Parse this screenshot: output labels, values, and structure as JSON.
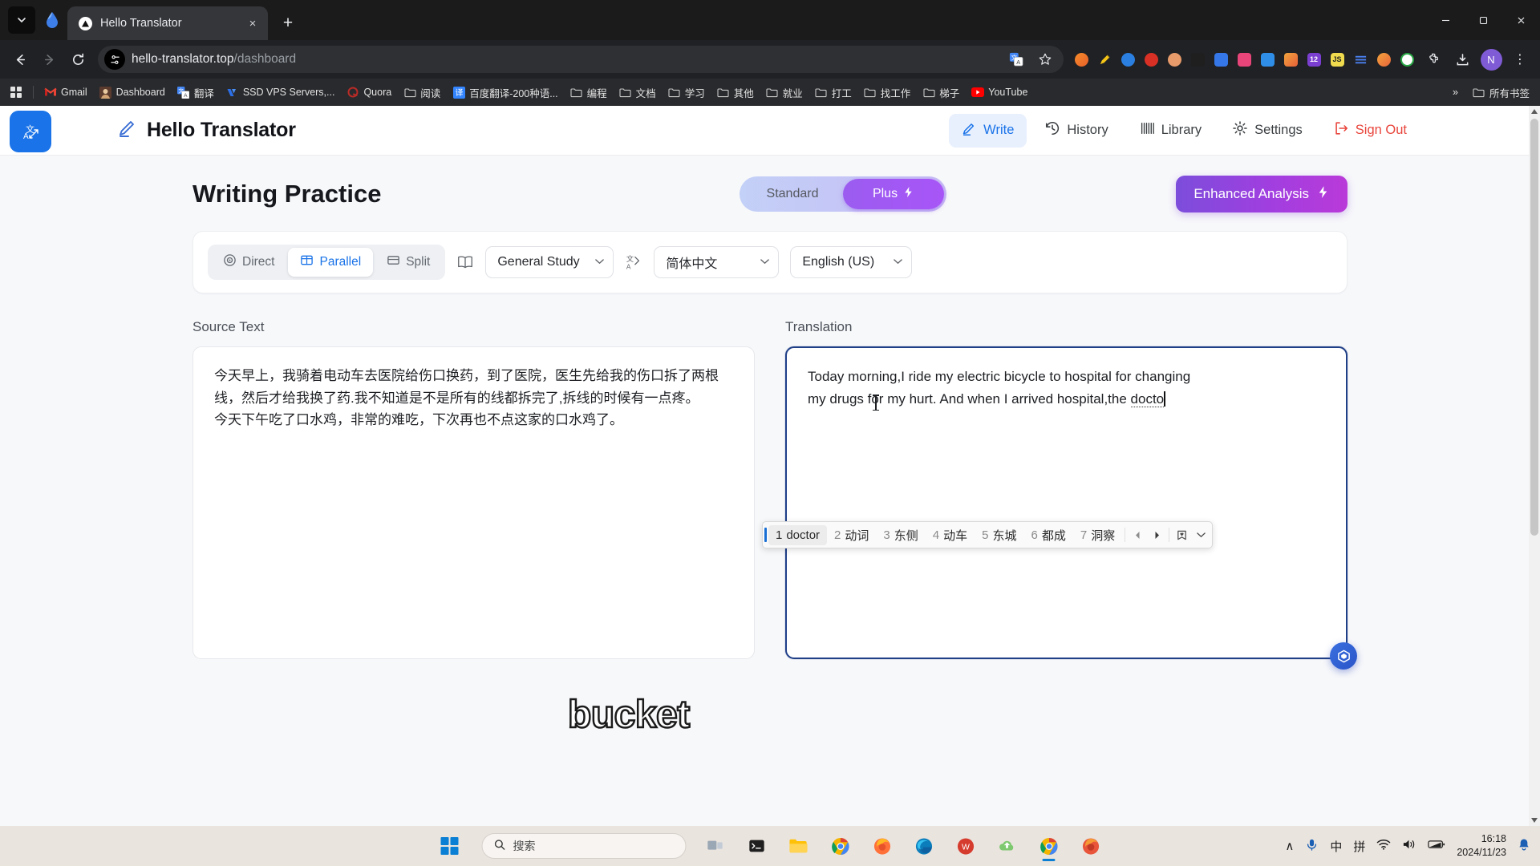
{
  "browser": {
    "tab": {
      "title": "Hello Translator",
      "close_label": "×",
      "favicon": "triangle-icon"
    },
    "new_tab_label": "+",
    "window_controls": {
      "minimize": "—",
      "maximize": "❐",
      "close": "✕"
    },
    "nav": {
      "back": "←",
      "forward": "→",
      "reload": "↻"
    },
    "omnibox": {
      "domain": "hello-translator.top",
      "path": "/dashboard",
      "site_info_icon": "tune-icon",
      "translate_icon": "translate-icon",
      "bookmark_icon": "star-icon"
    },
    "profile_initial": "N",
    "menu_icon": "⋮",
    "download_icon": "download-icon",
    "extensions_icon": "puzzle-icon",
    "bookmarks": [
      {
        "label": "Gmail",
        "icon": "gmail-icon"
      },
      {
        "label": "Dashboard",
        "icon": "dashboard-icon"
      },
      {
        "label": "翻译",
        "icon": "google-translate-icon"
      },
      {
        "label": "SSD VPS Servers,...",
        "icon": "vultr-icon"
      },
      {
        "label": "Quora",
        "icon": "quora-icon"
      },
      {
        "label": "阅读",
        "icon": "folder-icon"
      },
      {
        "label": "百度翻译-200种语...",
        "icon": "baidu-translate-icon"
      },
      {
        "label": "编程",
        "icon": "folder-icon"
      },
      {
        "label": "文档",
        "icon": "folder-icon"
      },
      {
        "label": "学习",
        "icon": "folder-icon"
      },
      {
        "label": "其他",
        "icon": "folder-icon"
      },
      {
        "label": "就业",
        "icon": "folder-icon"
      },
      {
        "label": "打工",
        "icon": "folder-icon"
      },
      {
        "label": "找工作",
        "icon": "folder-icon"
      },
      {
        "label": "梯子",
        "icon": "folder-icon"
      },
      {
        "label": "YouTube",
        "icon": "youtube-icon"
      }
    ],
    "bookmarks_overflow": "»",
    "all_bookmarks_label": "所有书签",
    "all_bookmarks_icon": "folder-icon",
    "extensions": [
      {
        "icon": "ext-orange-icon",
        "color": "#e8732a"
      },
      {
        "icon": "ext-pen-icon",
        "color": "#f5c518"
      },
      {
        "icon": "ext-blue-circle-icon",
        "color": "#2b7fe0"
      },
      {
        "icon": "ext-red-dot-icon",
        "color": "#dd3c2f"
      },
      {
        "icon": "ext-avatar-icon",
        "color": "#e79a6a"
      },
      {
        "icon": "ext-black-square-icon",
        "color": "#1f1f1f"
      },
      {
        "icon": "ext-blue-square-icon",
        "color": "#3577e8"
      },
      {
        "icon": "ext-pink-icon",
        "color": "#e8467a"
      },
      {
        "icon": "ext-cube-icon",
        "color": "#2f8fe8"
      },
      {
        "icon": "ext-grid-icon",
        "color": "#e86a3a"
      },
      {
        "icon": "ext-badge-12-icon",
        "color": "#7a3fd0",
        "badge": "12"
      },
      {
        "icon": "ext-js-icon",
        "color": "#f0db4f"
      },
      {
        "icon": "ext-list-icon",
        "color": "#4a80f0"
      },
      {
        "icon": "ext-green-check-icon",
        "color": "#28a745"
      }
    ]
  },
  "app": {
    "logo_icon": "translate-expand-icon",
    "brand": "Hello Translator",
    "brand_icon": "pencil-icon",
    "nav": [
      {
        "label": "Write",
        "icon": "pencil-icon",
        "active": true
      },
      {
        "label": "History",
        "icon": "history-icon",
        "active": false
      },
      {
        "label": "Library",
        "icon": "library-icon",
        "active": false
      },
      {
        "label": "Settings",
        "icon": "gear-icon",
        "active": false
      },
      {
        "label": "Sign Out",
        "icon": "signout-icon",
        "active": false
      }
    ],
    "page_title": "Writing Practice",
    "plan": {
      "standard_label": "Standard",
      "plus_label": "Plus",
      "plus_icon": "lightning-icon",
      "selected": "Plus"
    },
    "enhanced_button": {
      "label": "Enhanced Analysis",
      "icon": "lightning-icon"
    },
    "toolbar": {
      "modes": [
        {
          "label": "Direct",
          "icon": "target-icon",
          "selected": false
        },
        {
          "label": "Parallel",
          "icon": "columns-icon",
          "selected": true
        },
        {
          "label": "Split",
          "icon": "split-icon",
          "selected": false
        }
      ],
      "book_icon": "book-icon",
      "topic_select": {
        "value": "General Study",
        "chevron": "▾"
      },
      "lang_icon": "language-swap-icon",
      "source_lang_select": {
        "value": "简体中文",
        "chevron": "▾"
      },
      "target_lang_select": {
        "value": "English (US)",
        "chevron": "▾"
      }
    },
    "source_panel": {
      "label": "Source Text",
      "lines": [
        "今天早上，我骑着电动车去医院给伤口换药，到了医院，医生先给我的伤口拆了两根线，然后才给我换了药.我不知道是不是所有的线都拆完了,拆线的时候有一点疼。",
        "今天下午吃了口水鸡，非常的难吃，下次再也不点这家的口水鸡了。"
      ]
    },
    "target_panel": {
      "label": "Translation",
      "text_before": "Today morning,I ride my electric bicycle to changing my drugs for my hurt. And when I arrived hospital,the ",
      "line1": "Today morning,I ride my electric bicycle to hospital for changing",
      "line2_a": "my drugs for my hurt. And when I arrived hospital,the ",
      "line2_composition": "docto"
    },
    "watermark": "bucket",
    "fab_icon": "assistant-icon"
  },
  "ime": {
    "candidates": [
      {
        "num": "1",
        "text": "doctor",
        "selected": true
      },
      {
        "num": "2",
        "text": "动词",
        "selected": false
      },
      {
        "num": "3",
        "text": "东侧",
        "selected": false
      },
      {
        "num": "4",
        "text": "动车",
        "selected": false
      },
      {
        "num": "5",
        "text": "东城",
        "selected": false
      },
      {
        "num": "6",
        "text": "都成",
        "selected": false
      },
      {
        "num": "7",
        "text": "洞察",
        "selected": false
      }
    ],
    "prev_icon": "◀",
    "next_icon": "▶",
    "tool_icon": "ime-tool-icon",
    "expand_icon": "⌄"
  },
  "taskbar": {
    "start_icon": "windows-icon",
    "search_placeholder": "搜索",
    "search_icon": "search-icon",
    "apps": [
      {
        "icon": "task-view-icon",
        "running": false
      },
      {
        "icon": "terminal-icon",
        "running": false
      },
      {
        "icon": "file-explorer-icon",
        "running": false
      },
      {
        "icon": "chrome-icon",
        "running": false
      },
      {
        "icon": "firefox-icon",
        "running": false
      },
      {
        "icon": "edge-icon",
        "running": false
      },
      {
        "icon": "wps-icon",
        "running": false
      },
      {
        "icon": "cloud-icon",
        "running": false
      },
      {
        "icon": "chrome-active-icon",
        "running": true
      },
      {
        "icon": "firefox-dev-icon",
        "running": false
      }
    ],
    "tray": {
      "chevron_up": "∧",
      "mic_icon": "mic-icon",
      "ime_mode": "中",
      "ime_pinyin": "拼",
      "wifi_icon": "wifi-icon",
      "volume_icon": "volume-icon",
      "battery_icon": "battery-icon",
      "time": "16:18",
      "date": "2024/11/23",
      "notification_icon": "bell-icon"
    }
  },
  "colors": {
    "accent_blue": "#1a73e8",
    "purple": "#a855f7",
    "signout_red": "#e8453c",
    "chrome_dark": "#202124"
  }
}
